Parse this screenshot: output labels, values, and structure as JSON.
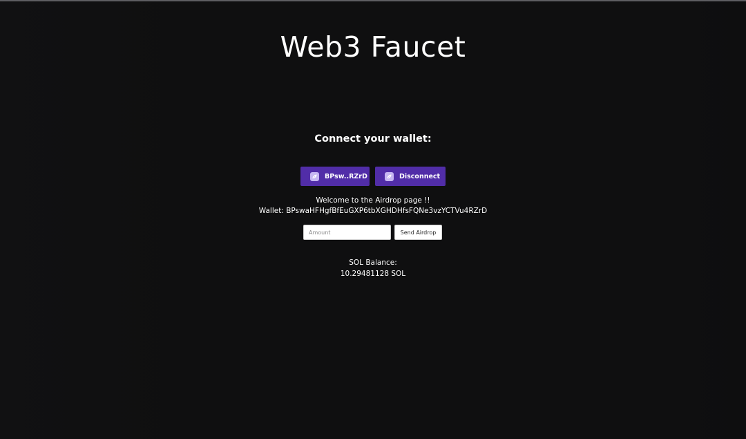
{
  "page": {
    "title": "Web3 Faucet"
  },
  "wallet": {
    "heading": "Connect your wallet:",
    "address_button_label": "BPsw..RZrD",
    "disconnect_button_label": "Disconnect",
    "button_color": "#512da8",
    "icon": "wallet-adapter-icon"
  },
  "airdrop": {
    "welcome_text": "Welcome to the Airdrop page !!",
    "wallet_line": "Wallet: BPswaHFHgfBfEuGXP6tbXGHDHfsFQNe3vzYCTVu4RZrD",
    "amount_placeholder": "Amount",
    "amount_value": "",
    "send_button_label": "Send Airdrop"
  },
  "balance": {
    "label": "SOL Balance:",
    "value": "10.29481128 SOL"
  }
}
